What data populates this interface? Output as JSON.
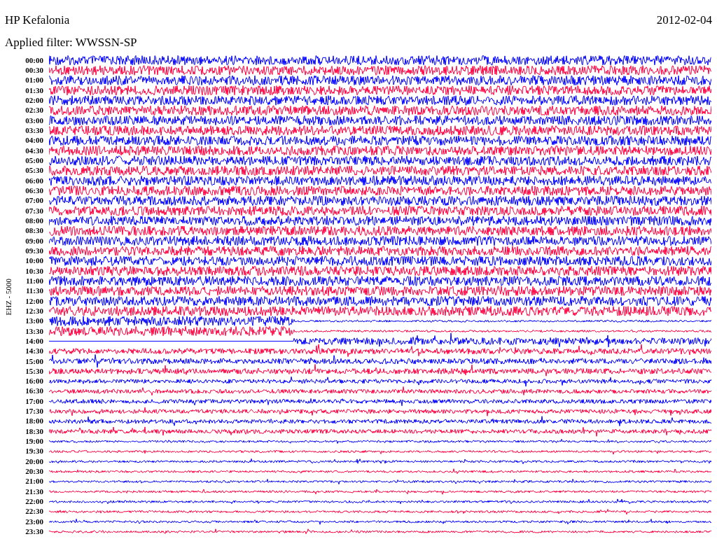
{
  "title": "HP Kefalonia",
  "date": "2012-02-04",
  "filter": "Applied filter: WWSSN-SP",
  "channel": "EHZ - 5000",
  "rows": [
    {
      "time": "00:00",
      "color": "#0000ff"
    },
    {
      "time": "00:30",
      "color": "#ff0040"
    },
    {
      "time": "01:00",
      "color": "#0000ff"
    },
    {
      "time": "01:30",
      "color": "#ff0040"
    },
    {
      "time": "02:00",
      "color": "#0000ff"
    },
    {
      "time": "02:30",
      "color": "#ff0040"
    },
    {
      "time": "03:00",
      "color": "#0000ff"
    },
    {
      "time": "03:30",
      "color": "#ff0040"
    },
    {
      "time": "04:00",
      "color": "#0000ff"
    },
    {
      "time": "04:30",
      "color": "#ff0040"
    },
    {
      "time": "05:00",
      "color": "#0000ff"
    },
    {
      "time": "05:30",
      "color": "#ff0040"
    },
    {
      "time": "06:00",
      "color": "#0000ff"
    },
    {
      "time": "06:30",
      "color": "#ff0040"
    },
    {
      "time": "07:00",
      "color": "#0000ff"
    },
    {
      "time": "07:30",
      "color": "#ff0040"
    },
    {
      "time": "08:00",
      "color": "#0000ff"
    },
    {
      "time": "08:30",
      "color": "#ff0040"
    },
    {
      "time": "09:00",
      "color": "#0000ff"
    },
    {
      "time": "09:30",
      "color": "#ff0040"
    },
    {
      "time": "10:00",
      "color": "#0000ff"
    },
    {
      "time": "10:30",
      "color": "#ff0040"
    },
    {
      "time": "11:00",
      "color": "#0000ff"
    },
    {
      "time": "11:30",
      "color": "#ff0040"
    },
    {
      "time": "12:00",
      "color": "#0000ff"
    },
    {
      "time": "12:30",
      "color": "#ff0040"
    },
    {
      "time": "13:00",
      "color": "#0000ff"
    },
    {
      "time": "13:30",
      "color": "#ff0040"
    },
    {
      "time": "14:00",
      "color": "#0000ff"
    },
    {
      "time": "14:30",
      "color": "#ff0040"
    },
    {
      "time": "15:00",
      "color": "#0000ff"
    },
    {
      "time": "15:30",
      "color": "#ff0040"
    },
    {
      "time": "16:00",
      "color": "#0000ff"
    },
    {
      "time": "16:30",
      "color": "#ff0040"
    },
    {
      "time": "17:00",
      "color": "#0000ff"
    },
    {
      "time": "17:30",
      "color": "#ff0040"
    },
    {
      "time": "18:00",
      "color": "#0000ff"
    },
    {
      "time": "18:30",
      "color": "#ff0040"
    },
    {
      "time": "19:00",
      "color": "#0000ff"
    },
    {
      "time": "19:30",
      "color": "#ff0040"
    },
    {
      "time": "20:00",
      "color": "#0000ff"
    },
    {
      "time": "20:30",
      "color": "#ff0040"
    },
    {
      "time": "21:00",
      "color": "#0000ff"
    },
    {
      "time": "21:30",
      "color": "#ff0040"
    },
    {
      "time": "22:00",
      "color": "#0000ff"
    },
    {
      "time": "22:30",
      "color": "#ff0040"
    },
    {
      "time": "23:00",
      "color": "#0000ff"
    },
    {
      "time": "23:30",
      "color": "#ff0040"
    }
  ]
}
